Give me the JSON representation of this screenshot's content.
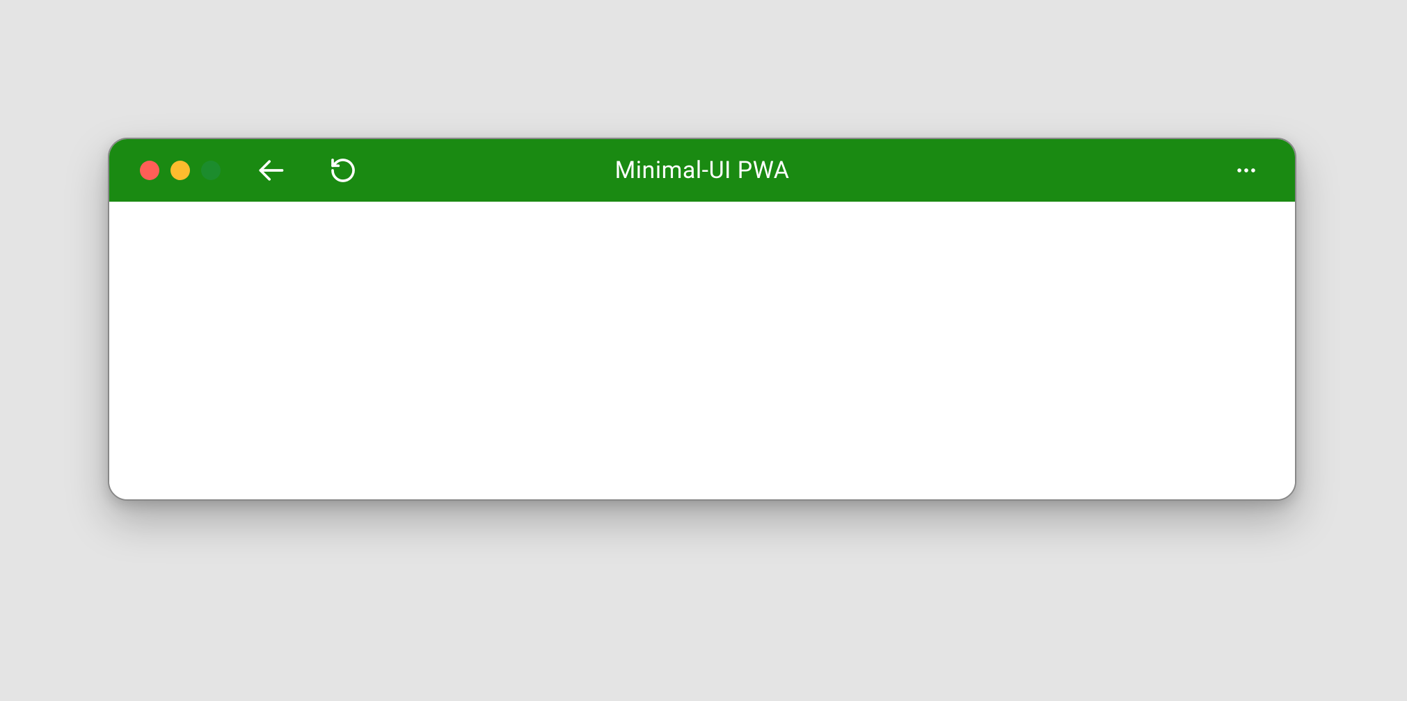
{
  "window": {
    "title": "Minimal-UI PWA"
  },
  "colors": {
    "titlebar_bg": "#1a8a12",
    "page_bg": "#e4e4e4",
    "content_bg": "#ffffff",
    "traffic_close": "#ff5f57",
    "traffic_min": "#febc2e",
    "traffic_max": "#28c840"
  },
  "icons": {
    "back": "arrow-left",
    "reload": "refresh",
    "more": "ellipsis-horizontal"
  }
}
